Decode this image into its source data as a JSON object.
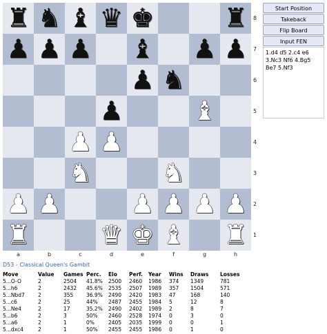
{
  "board": {
    "ranks": [
      "8",
      "7",
      "6",
      "5",
      "4",
      "3",
      "2",
      "1"
    ],
    "files": [
      "a",
      "b",
      "c",
      "d",
      "e",
      "f",
      "g",
      "h"
    ],
    "rows": [
      [
        "r",
        "n",
        "b",
        "q",
        "k",
        "",
        "",
        "r"
      ],
      [
        "p",
        "p",
        "p",
        "",
        "b",
        "",
        "p",
        "p"
      ],
      [
        "",
        "",
        "",
        "",
        "p",
        "n",
        "",
        ""
      ],
      [
        "",
        "",
        "",
        "p",
        "",
        "",
        "B",
        ""
      ],
      [
        "",
        "",
        "P",
        "P",
        "",
        "",
        "",
        ""
      ],
      [
        "",
        "",
        "N",
        "",
        "",
        "N",
        "",
        ""
      ],
      [
        "P",
        "P",
        "",
        "",
        "P",
        "P",
        "P",
        "P"
      ],
      [
        "R",
        "",
        "",
        "Q",
        "K",
        "B",
        "",
        "R"
      ]
    ],
    "glyphs": {
      "K": "♚",
      "Q": "♛",
      "R": "♜",
      "B": "♝",
      "N": "♞",
      "P": "♟",
      "k": "♚",
      "q": "♛",
      "r": "♜",
      "b": "♝",
      "n": "♞",
      "p": "♟"
    }
  },
  "buttons": {
    "start": "Start Position",
    "takeback": "Takeback",
    "flip": "Flip Board",
    "fen": "Input FEN"
  },
  "moves_text": "1.d4 d5 2.c4 e6 3.Nc3 Nf6 4.Bg5 Be7 5.Nf3",
  "opening": "D53 - Classical Queen's Gambit",
  "stats": {
    "headers": [
      "Move",
      "Value",
      "Games",
      "Perc.",
      "Elo",
      "Perf.",
      "Year",
      "Wins",
      "Draws",
      "Losses"
    ],
    "rows": [
      [
        "5...O-O",
        "2",
        "2504",
        "41.8%",
        "2500",
        "2460",
        "1986",
        "374",
        "1349",
        "781"
      ],
      [
        "5...h6",
        "2",
        "2432",
        "45.6%",
        "2535",
        "2507",
        "1989",
        "357",
        "1504",
        "571"
      ],
      [
        "5...Nbd7",
        "2",
        "355",
        "36.9%",
        "2490",
        "2420",
        "1983",
        "47",
        "168",
        "140"
      ],
      [
        "5...c6",
        "2",
        "25",
        "44%",
        "2487",
        "2455",
        "1984",
        "5",
        "12",
        "8"
      ],
      [
        "5...Ne4",
        "2",
        "17",
        "35.2%",
        "2490",
        "2402",
        "1989",
        "2",
        "8",
        "7"
      ],
      [
        "5...b6",
        "2",
        "3",
        "50%",
        "2460",
        "2528",
        "1974",
        "0",
        "3",
        "0"
      ],
      [
        "5...a6",
        "2",
        "1",
        "0%",
        "2405",
        "2035",
        "1999",
        "0",
        "0",
        "1"
      ],
      [
        "5...dxc4",
        "2",
        "1",
        "50%",
        "2455",
        "2455",
        "1986",
        "0",
        "1",
        "0"
      ]
    ]
  }
}
